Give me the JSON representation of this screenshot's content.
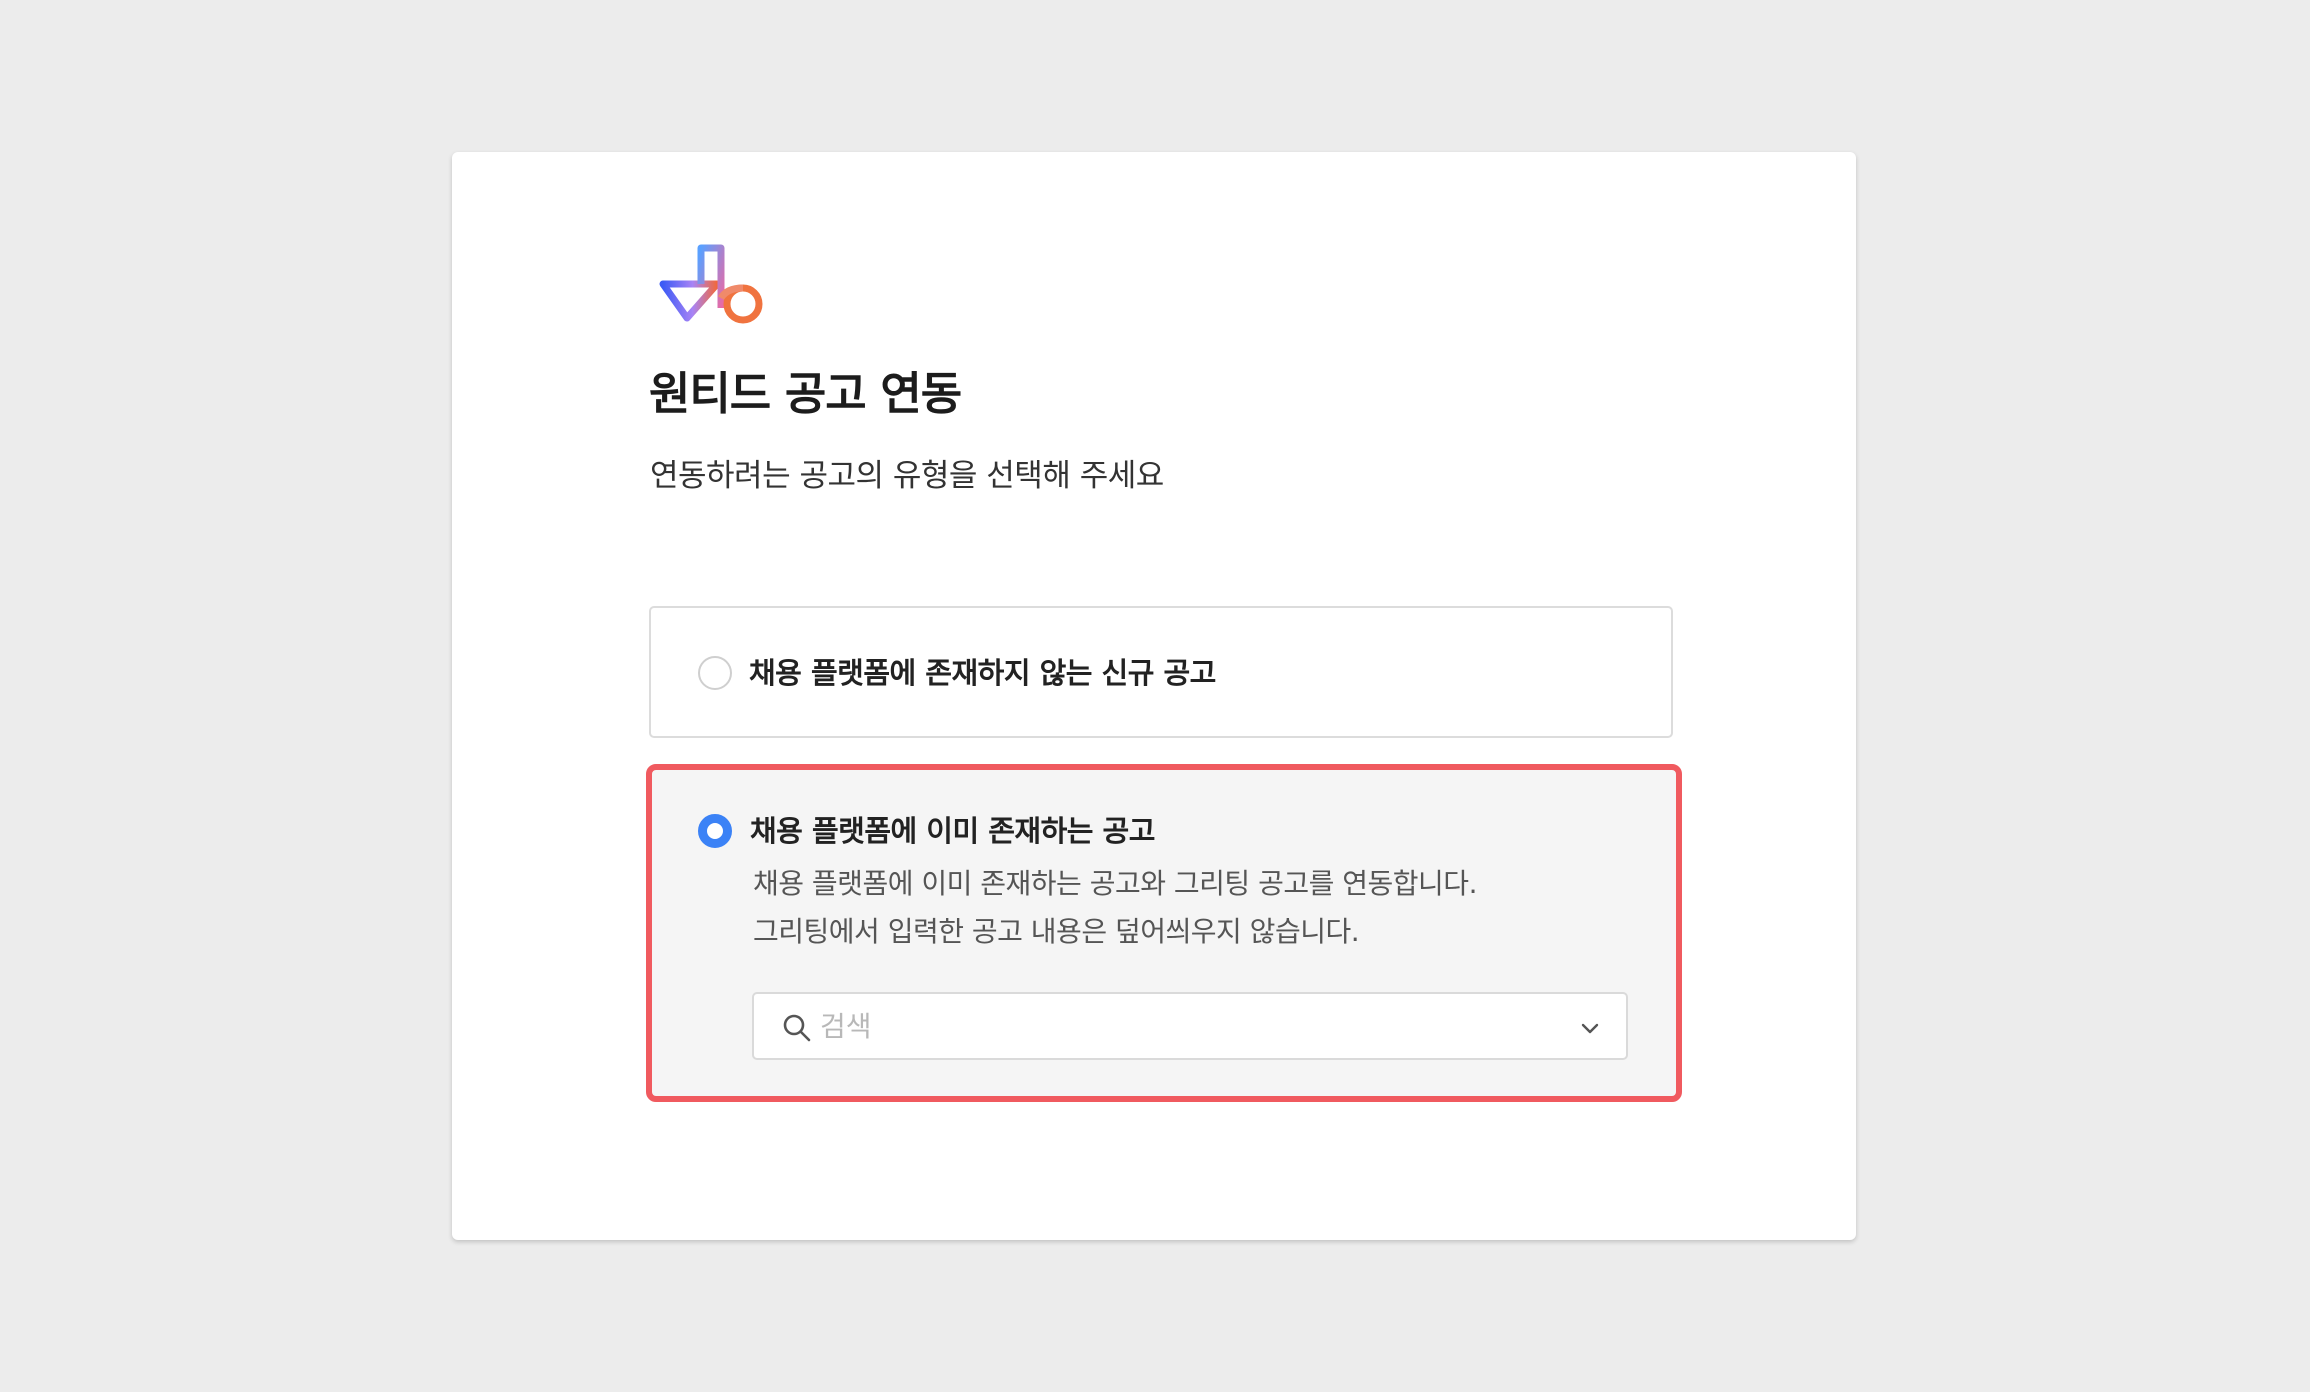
{
  "dialog": {
    "title": "원티드 공고 연동",
    "subtitle": "연동하려는 공고의 유형을 선택해 주세요"
  },
  "options": [
    {
      "label": "채용 플랫폼에 존재하지 않는 신규 공고",
      "selected": false
    },
    {
      "label": "채용 플랫폼에 이미 존재하는 공고",
      "selected": true,
      "description_1": "채용 플랫폼에 이미 존재하는 공고와 그리팅 공고를 연동합니다.",
      "description_2": "그리팅에서 입력한 공고 내용은 덮어씌우지 않습니다."
    }
  ],
  "search": {
    "placeholder": "검색",
    "value": ""
  },
  "colors": {
    "accent": "#3b82f6",
    "highlight_border": "#f05a5f",
    "page_background": "#ececec"
  },
  "icons": {
    "logo": "wanted-logo",
    "search": "search-icon",
    "dropdown": "chevron-down-icon"
  }
}
